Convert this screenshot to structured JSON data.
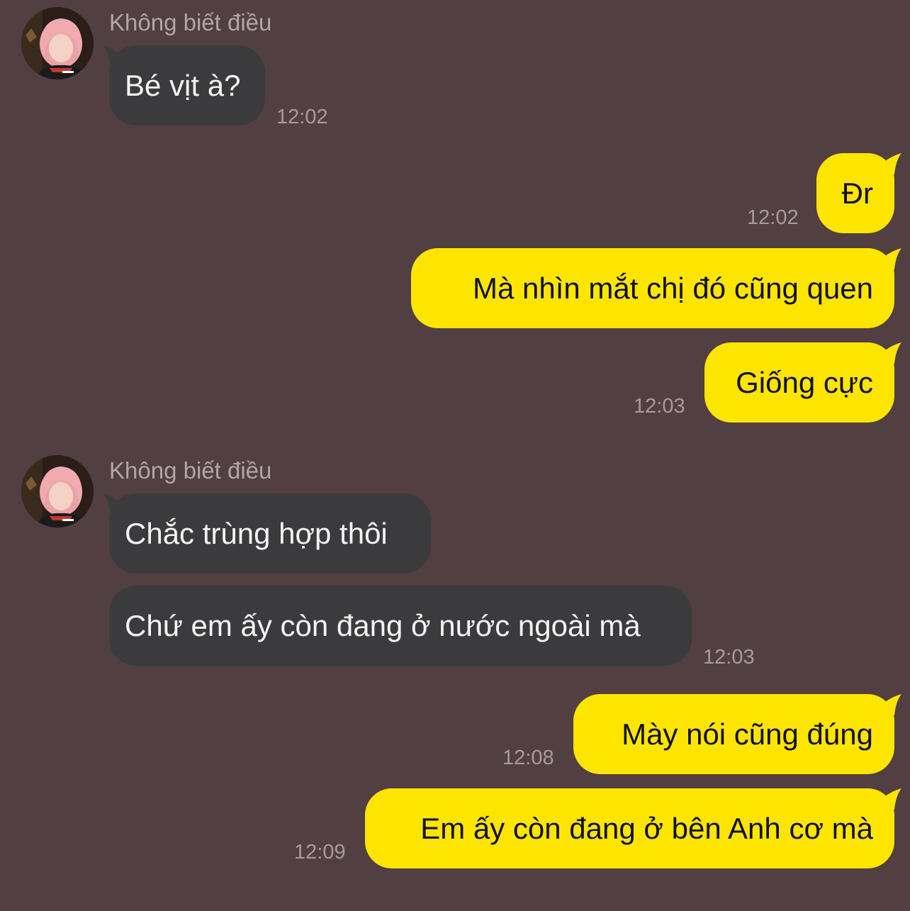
{
  "conversation": {
    "groups": [
      {
        "sender": "Không biết điều",
        "messages": [
          {
            "text": "Bé vịt à?",
            "time": "12:02"
          }
        ]
      },
      {
        "sender": "me",
        "messages": [
          {
            "text": "Đr",
            "time": "12:02"
          },
          {
            "text": "Mà nhìn mắt chị đó cũng quen",
            "time": ""
          },
          {
            "text": "Giống cực",
            "time": "12:03"
          }
        ]
      },
      {
        "sender": "Không biết điều",
        "messages": [
          {
            "text": "Chắc trùng hợp thôi",
            "time": ""
          },
          {
            "text": "Chứ em ấy còn đang ở nước ngoài mà",
            "time": "12:03"
          }
        ]
      },
      {
        "sender": "me",
        "messages": [
          {
            "text": "Mày nói cũng đúng",
            "time": "12:08"
          },
          {
            "text": "Em ấy còn đang ở bên Anh cơ mà",
            "time": "12:09"
          }
        ]
      }
    ]
  },
  "colors": {
    "background": "#523f41",
    "incoming_bubble": "#3b3b3d",
    "outgoing_bubble": "#fee500",
    "timestamp": "#a99a9b",
    "sender_name": "#b3a5a6"
  },
  "icons": {
    "avatar": "avatar-pink-hair"
  }
}
